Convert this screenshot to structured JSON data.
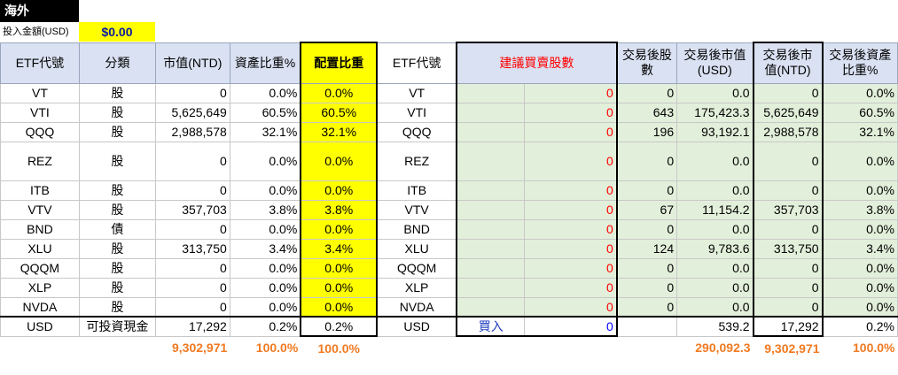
{
  "header": {
    "title": "海外",
    "amount_label": "投入金額(USD)",
    "amount_value": "$0.00"
  },
  "columns": [
    "ETF代號",
    "分類",
    "市值(NTD)",
    "資產比重%",
    "配置比重",
    "ETF代號",
    "建議買賣股數",
    "",
    "交易後股數",
    "交易後市值(USD)",
    "交易後市值(NTD)",
    "交易後資產比重%"
  ],
  "rows": [
    {
      "code": "VT",
      "cat": "股",
      "mv": "0",
      "ratio": "0.0%",
      "alloc": "0.0%",
      "code2": "VT",
      "shares": "0",
      "after_shares": "0",
      "after_usd": "0.0",
      "after_ntd": "0",
      "after_ratio": "0.0%"
    },
    {
      "code": "VTI",
      "cat": "股",
      "mv": "5,625,649",
      "ratio": "60.5%",
      "alloc": "60.5%",
      "code2": "VTI",
      "shares": "0",
      "after_shares": "643",
      "after_usd": "175,423.3",
      "after_ntd": "5,625,649",
      "after_ratio": "60.5%"
    },
    {
      "code": "QQQ",
      "cat": "股",
      "mv": "2,988,578",
      "ratio": "32.1%",
      "alloc": "32.1%",
      "code2": "QQQ",
      "shares": "0",
      "after_shares": "196",
      "after_usd": "93,192.1",
      "after_ntd": "2,988,578",
      "after_ratio": "32.1%"
    },
    {
      "code": "REZ",
      "cat": "股",
      "mv": "0",
      "ratio": "0.0%",
      "alloc": "0.0%",
      "code2": "REZ",
      "shares": "0",
      "after_shares": "0",
      "after_usd": "0.0",
      "after_ntd": "0",
      "after_ratio": "0.0%"
    },
    {
      "code": "ITB",
      "cat": "股",
      "mv": "0",
      "ratio": "0.0%",
      "alloc": "0.0%",
      "code2": "ITB",
      "shares": "0",
      "after_shares": "0",
      "after_usd": "0.0",
      "after_ntd": "0",
      "after_ratio": "0.0%"
    },
    {
      "code": "VTV",
      "cat": "股",
      "mv": "357,703",
      "ratio": "3.8%",
      "alloc": "3.8%",
      "code2": "VTV",
      "shares": "0",
      "after_shares": "67",
      "after_usd": "11,154.2",
      "after_ntd": "357,703",
      "after_ratio": "3.8%"
    },
    {
      "code": "BND",
      "cat": "債",
      "mv": "0",
      "ratio": "0.0%",
      "alloc": "0.0%",
      "code2": "BND",
      "shares": "0",
      "after_shares": "0",
      "after_usd": "0.0",
      "after_ntd": "0",
      "after_ratio": "0.0%"
    },
    {
      "code": "XLU",
      "cat": "股",
      "mv": "313,750",
      "ratio": "3.4%",
      "alloc": "3.4%",
      "code2": "XLU",
      "shares": "0",
      "after_shares": "124",
      "after_usd": "9,783.6",
      "after_ntd": "313,750",
      "after_ratio": "3.4%"
    },
    {
      "code": "QQQM",
      "cat": "股",
      "mv": "0",
      "ratio": "0.0%",
      "alloc": "0.0%",
      "code2": "QQQM",
      "shares": "0",
      "after_shares": "0",
      "after_usd": "0.0",
      "after_ntd": "0",
      "after_ratio": "0.0%"
    },
    {
      "code": "XLP",
      "cat": "股",
      "mv": "0",
      "ratio": "0.0%",
      "alloc": "0.0%",
      "code2": "XLP",
      "shares": "0",
      "after_shares": "0",
      "after_usd": "0.0",
      "after_ntd": "0",
      "after_ratio": "0.0%"
    },
    {
      "code": "NVDA",
      "cat": "股",
      "mv": "0",
      "ratio": "0.0%",
      "alloc": "0.0%",
      "code2": "NVDA",
      "shares": "0",
      "after_shares": "0",
      "after_usd": "0.0",
      "after_ntd": "0",
      "after_ratio": "0.0%"
    }
  ],
  "usd_row": {
    "code": "USD",
    "cat": "可投資現金",
    "mv": "17,292",
    "ratio": "0.2%",
    "alloc": "0.2%",
    "code2": "USD",
    "action": "買入",
    "shares": "0",
    "after_shares": "",
    "after_usd": "539.2",
    "after_ntd": "17,292",
    "after_ratio": "0.2%"
  },
  "totals": {
    "mv": "9,302,971",
    "ratio": "100.0%",
    "alloc": "100.0%",
    "after_usd": "290,092.3",
    "after_ntd": "9,302,971",
    "after_ratio": "100.0%"
  },
  "colors": {
    "alloc_fill": "#ffff00",
    "header_fill": "#d9e1f2",
    "suggest_fill": "#e2efda",
    "shares_text": "#ff0000",
    "totals_text": "#f07a22"
  }
}
